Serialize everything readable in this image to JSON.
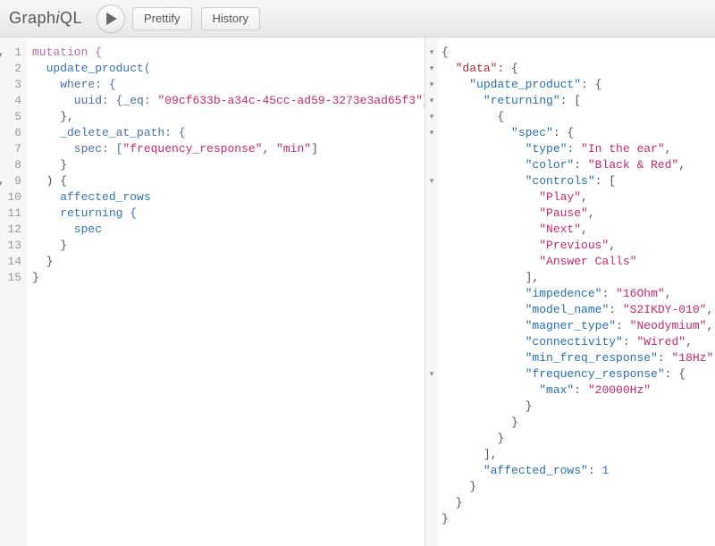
{
  "header": {
    "logo_pre": "Graph",
    "logo_i": "i",
    "logo_post": "QL",
    "prettify": "Prettify",
    "history": "History"
  },
  "query": {
    "l1": "mutation {",
    "l2_a": "  update_product(",
    "l3_a": "    where: {",
    "l4_a": "      uuid: {",
    "l4_b": "_eq: ",
    "l4_s": "\"09cf633b-a34c-45cc-ad59-3273e3ad65f3\"",
    "l4_c": "}",
    "l5": "    },",
    "l6": "    _delete_at_path: {",
    "l7_a": "      spec: [",
    "l7_s1": "\"frequency_response\"",
    "l7_c": ", ",
    "l7_s2": "\"min\"",
    "l7_b": "]",
    "l8": "    }",
    "l9": "  ) {",
    "l10": "    affected_rows",
    "l11": "    returning {",
    "l12": "      spec",
    "l13": "    }",
    "l14": "  }",
    "l15": "}"
  },
  "result": {
    "data": {
      "update_product": {
        "returning": [
          {
            "spec": {
              "type": "In the ear",
              "color": "Black & Red",
              "controls": [
                "Play",
                "Pause",
                "Next",
                "Previous",
                "Answer Calls"
              ],
              "impedence": "16Ohm",
              "model_name": "S2IKDY-010",
              "magner_type": "Neodymium",
              "connectivity": "Wired",
              "min_freq_response": "18Hz",
              "frequency_response": {
                "max": "20000Hz"
              }
            }
          }
        ],
        "affected_rows": 1
      }
    }
  },
  "line_numbers": [
    "1",
    "2",
    "3",
    "4",
    "5",
    "6",
    "7",
    "8",
    "9",
    "10",
    "11",
    "12",
    "13",
    "14",
    "15"
  ],
  "fold_lines": [
    1,
    9
  ]
}
